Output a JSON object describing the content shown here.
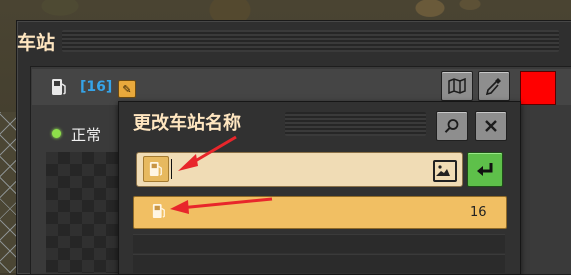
{
  "window": {
    "title": "车站"
  },
  "station": {
    "id_label": "[16]",
    "status": "正常"
  },
  "dialog": {
    "title": "更改车站名称",
    "name_input_value": "",
    "results": [
      {
        "icon": "fuel-icon",
        "count": "16"
      }
    ]
  },
  "colors": {
    "accent_orange": "#e9a93c",
    "id_blue": "#36a4e8",
    "status_green": "#8ee04a",
    "confirm_green": "#5ec04a",
    "highlight_row": "#f1bf63",
    "annotation_red": "#e8262b",
    "color_swatch": "#ff0000"
  },
  "icons": {
    "map": "map-icon",
    "eyedropper": "eyedropper-icon",
    "search": "search-icon",
    "close": "close-icon",
    "image": "image-icon",
    "confirm": "enter-icon",
    "edit": "pencil-icon"
  }
}
